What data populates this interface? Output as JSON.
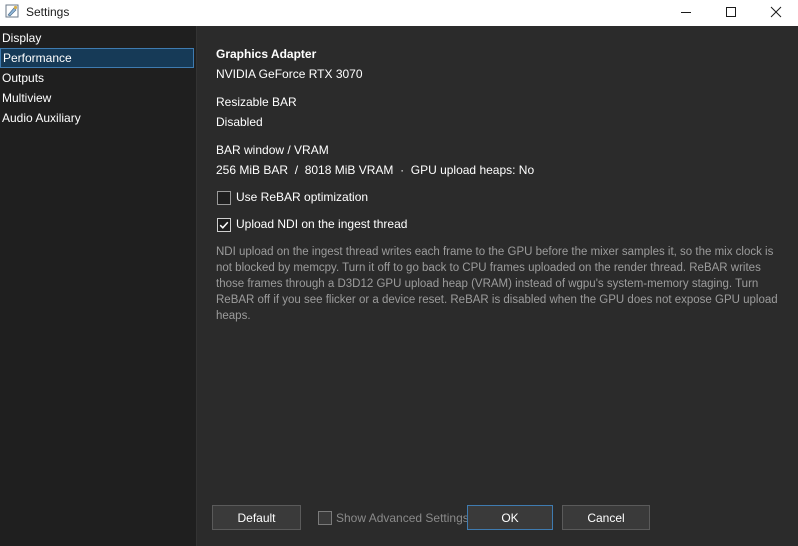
{
  "window": {
    "title": "Settings",
    "icon": "settings-gear-icon",
    "controls": [
      "minimize-icon",
      "maximize-icon",
      "close-icon"
    ]
  },
  "sidebar": {
    "items": [
      {
        "label": "Display",
        "active": false
      },
      {
        "label": "Performance",
        "active": true
      },
      {
        "label": "Outputs",
        "active": false
      },
      {
        "label": "Multiview",
        "active": false
      },
      {
        "label": "Audio Auxiliary",
        "active": false
      }
    ]
  },
  "performance": {
    "adapter_heading": "Graphics Adapter",
    "adapter_value": "NVIDIA GeForce RTX 3070",
    "rebar_heading": "Resizable BAR",
    "rebar_value": "Disabled",
    "bar_heading": "BAR window / VRAM",
    "bar_value": "256 MiB BAR  /  8018 MiB VRAM  ·  GPU upload heaps: No",
    "rebar_opt_label": "Use ReBAR optimization",
    "rebar_opt_checked": false,
    "ndi_label": "Upload NDI on the ingest thread",
    "ndi_checked": true,
    "help_text": "NDI upload on the ingest thread writes each frame to the GPU before the mixer samples it, so the mix clock is not blocked by memcpy. Turn it off to go back to CPU frames uploaded on the render thread. ReBAR writes those frames through a D3D12 GPU upload heap (VRAM) instead of wgpu's system-memory staging. Turn ReBAR off if you see flicker or a device reset. ReBAR is disabled when the GPU does not expose GPU upload heaps."
  },
  "footer": {
    "default_label": "Default",
    "advanced_label": "Show Advanced Settings",
    "advanced_checked": false,
    "ok_label": "OK",
    "cancel_label": "Cancel"
  },
  "colors": {
    "sidebar_bg": "#1f1f1f",
    "content_bg": "#2b2b2b",
    "active_item_bg": "#163a57",
    "accent_border": "#3f7bb0",
    "help_text": "#9c9c9c"
  }
}
